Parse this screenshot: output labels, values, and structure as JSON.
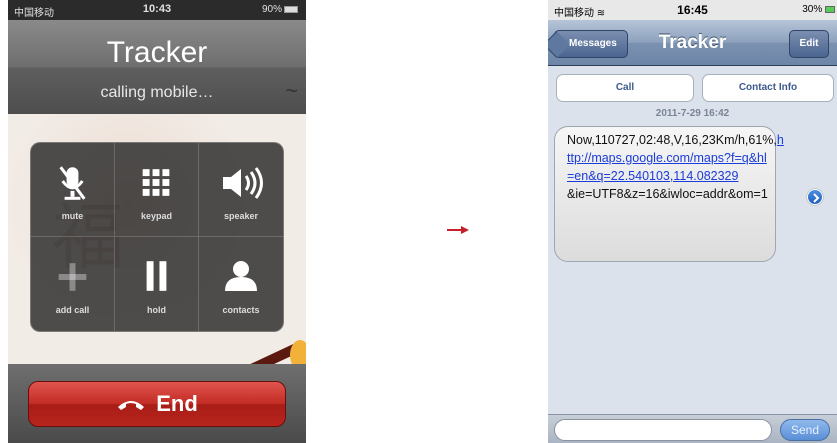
{
  "left_phone": {
    "status_bar": {
      "carrier": "中国移动",
      "time": "10:43",
      "battery": "90%"
    },
    "header": {
      "contact_name": "Tracker",
      "call_status": "calling mobile…"
    },
    "wallpaper_char": "福",
    "call_buttons": [
      {
        "label": "mute",
        "icon": "muted-microphone-icon"
      },
      {
        "label": "keypad",
        "icon": "keypad-grid-icon"
      },
      {
        "label": "speaker",
        "icon": "speaker-icon"
      },
      {
        "label": "add call",
        "icon": "plus-icon"
      },
      {
        "label": "hold",
        "icon": "pause-icon"
      },
      {
        "label": "contacts",
        "icon": "person-icon"
      }
    ],
    "end_button": {
      "label": "End",
      "icon": "hang-up-phone-icon",
      "color": "#c22b24"
    }
  },
  "right_phone": {
    "status_bar": {
      "carrier": "中国移动",
      "time": "16:45",
      "battery": "30%"
    },
    "nav": {
      "back_label": "Messages",
      "title": "Tracker",
      "edit_label": "Edit"
    },
    "actions": {
      "call_label": "Call",
      "contact_info_label": "Contact Info"
    },
    "timestamp": "2011-7-29 16:42",
    "message": {
      "prefix": "Now,110727,02:48,V,16,23Km/h,61%,",
      "link": "http://maps.google.com/maps?f=q&hl=en&q=22.540103,114.082329",
      "suffix": "&ie=UTF8&z=16&iwloc=addr&om=1"
    },
    "compose": {
      "placeholder": "",
      "send_label": "Send"
    },
    "accent_color": "#6d86a7"
  }
}
